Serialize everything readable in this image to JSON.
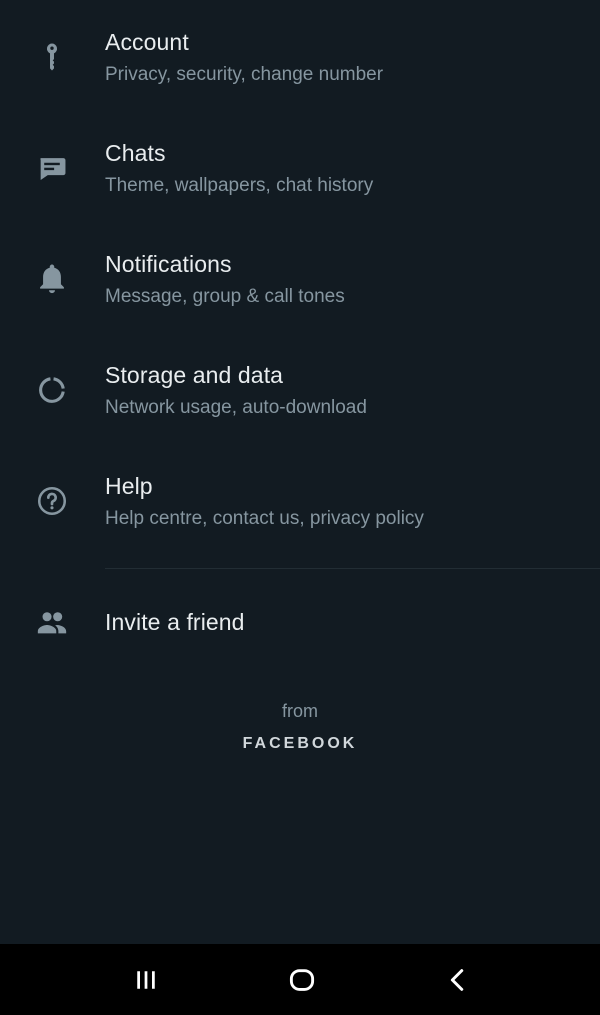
{
  "settings": {
    "items": [
      {
        "title": "Account",
        "subtitle": "Privacy, security, change number",
        "icon": "key-icon"
      },
      {
        "title": "Chats",
        "subtitle": "Theme, wallpapers, chat history",
        "icon": "chat-icon"
      },
      {
        "title": "Notifications",
        "subtitle": "Message, group & call tones",
        "icon": "bell-icon"
      },
      {
        "title": "Storage and data",
        "subtitle": "Network usage, auto-download",
        "icon": "data-usage-icon"
      },
      {
        "title": "Help",
        "subtitle": "Help centre, contact us, privacy policy",
        "icon": "help-icon"
      }
    ],
    "invite": {
      "title": "Invite a friend",
      "icon": "people-icon"
    }
  },
  "footer": {
    "from_label": "from",
    "brand": "FACEBOOK"
  },
  "navbar": {
    "buttons": [
      {
        "icon": "recent-apps-icon"
      },
      {
        "icon": "home-icon"
      },
      {
        "icon": "back-icon"
      }
    ]
  },
  "colors": {
    "background": "#121b22",
    "title_text": "#e9edef",
    "subtitle_text": "#8696a0",
    "icon": "#8696a0",
    "navbar": "#000000"
  }
}
